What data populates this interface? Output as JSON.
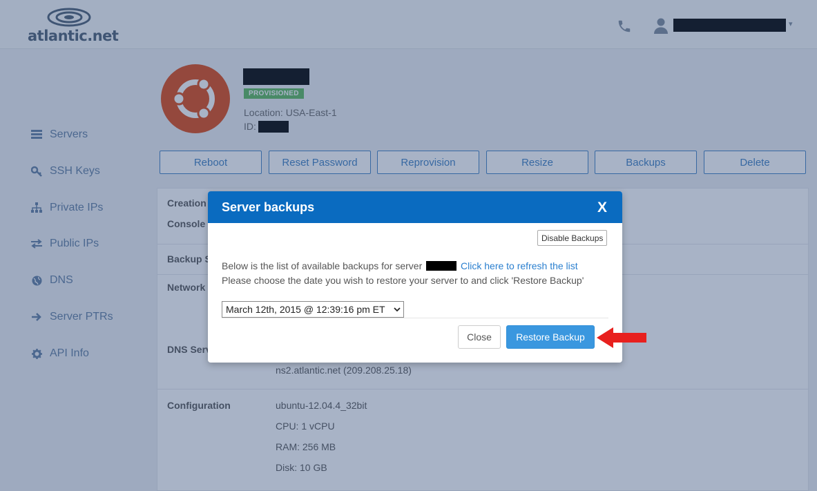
{
  "header": {
    "logo_text": "atlantic.net",
    "user_caret": "▾"
  },
  "sidebar": {
    "items": [
      {
        "label": "Servers",
        "icon": "servers-icon"
      },
      {
        "label": "SSH Keys",
        "icon": "key-icon"
      },
      {
        "label": "Private IPs",
        "icon": "network-icon"
      },
      {
        "label": "Public IPs",
        "icon": "exchange-icon"
      },
      {
        "label": "DNS",
        "icon": "globe-icon"
      },
      {
        "label": "Server PTRs",
        "icon": "arrow-right-icon"
      },
      {
        "label": "API Info",
        "icon": "gear-icon"
      }
    ]
  },
  "server": {
    "status": "PROVISIONED",
    "location": "Location: USA-East-1",
    "id_label": "ID:"
  },
  "actions": [
    "Reboot",
    "Reset Password",
    "Reprovision",
    "Resize",
    "Backups",
    "Delete"
  ],
  "details": {
    "labels": [
      "Creation",
      "Console",
      "Backup S",
      "Network",
      "DNS Serv",
      "Configuration"
    ],
    "dns_server_2": "ns2.atlantic.net (209.208.25.18)",
    "configuration": [
      "ubuntu-12.04.4_32bit",
      "CPU: 1 vCPU",
      "RAM: 256 MB",
      "Disk: 10 GB"
    ]
  },
  "modal": {
    "title": "Server backups",
    "close_x": "X",
    "disable_label": "Disable Backups",
    "line1_prefix": "Below is the list of available backups for server",
    "refresh_link": "Click here to refresh the list",
    "line2": "Please choose the date you wish to restore your server to and click 'Restore Backup'",
    "selected_backup": "March 12th, 2015 @ 12:39:16 pm ET",
    "close_label": "Close",
    "restore_label": "Restore Backup"
  },
  "colors": {
    "modal_header": "#0a6bc0",
    "primary_button": "#3a97df",
    "link": "#2a7fcf",
    "annotation_arrow": "#e8201e",
    "status_badge": "#5cb85c"
  }
}
